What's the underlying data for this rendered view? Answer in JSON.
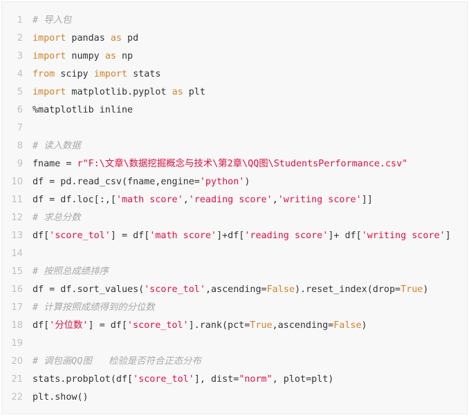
{
  "language": "python",
  "colors": {
    "background": "#f8f8f8",
    "keyword": "#d2822c",
    "string": "#dd1144",
    "comment": "#a8a8a8",
    "text": "#333333",
    "line_number": "#c0c0c0"
  },
  "lines": [
    {
      "n": "1",
      "tokens": [
        {
          "t": "cm",
          "v": "# 导入包"
        }
      ]
    },
    {
      "n": "2",
      "tokens": [
        {
          "t": "kw",
          "v": "import"
        },
        {
          "t": "nm",
          "v": " pandas "
        },
        {
          "t": "kw",
          "v": "as"
        },
        {
          "t": "nm",
          "v": " pd"
        }
      ]
    },
    {
      "n": "3",
      "tokens": [
        {
          "t": "kw",
          "v": "import"
        },
        {
          "t": "nm",
          "v": " numpy "
        },
        {
          "t": "kw",
          "v": "as"
        },
        {
          "t": "nm",
          "v": " np"
        }
      ]
    },
    {
      "n": "4",
      "tokens": [
        {
          "t": "kw",
          "v": "from"
        },
        {
          "t": "nm",
          "v": " scipy "
        },
        {
          "t": "kw",
          "v": "import"
        },
        {
          "t": "nm",
          "v": " stats"
        }
      ]
    },
    {
      "n": "5",
      "tokens": [
        {
          "t": "kw",
          "v": "import"
        },
        {
          "t": "nm",
          "v": " matplotlib.pyplot "
        },
        {
          "t": "kw",
          "v": "as"
        },
        {
          "t": "nm",
          "v": " plt"
        }
      ]
    },
    {
      "n": "6",
      "tokens": [
        {
          "t": "nm",
          "v": "%matplotlib inline"
        }
      ]
    },
    {
      "n": "7",
      "tokens": []
    },
    {
      "n": "8",
      "tokens": [
        {
          "t": "cm",
          "v": "# 读入数据"
        }
      ]
    },
    {
      "n": "9",
      "tokens": [
        {
          "t": "nm",
          "v": "fname = "
        },
        {
          "t": "str",
          "v": "r\"F:\\文章\\数据挖掘概念与技术\\第2章\\QQ图\\StudentsPerformance.csv\""
        }
      ]
    },
    {
      "n": "10",
      "tokens": [
        {
          "t": "nm",
          "v": "df = pd.read_csv(fname,engine="
        },
        {
          "t": "str",
          "v": "'python'"
        },
        {
          "t": "nm",
          "v": ")"
        }
      ]
    },
    {
      "n": "11",
      "tokens": [
        {
          "t": "nm",
          "v": "df = df.loc[:,["
        },
        {
          "t": "str",
          "v": "'math score'"
        },
        {
          "t": "nm",
          "v": ","
        },
        {
          "t": "str",
          "v": "'reading score'"
        },
        {
          "t": "nm",
          "v": ","
        },
        {
          "t": "str",
          "v": "'writing score'"
        },
        {
          "t": "nm",
          "v": "]]"
        }
      ]
    },
    {
      "n": "12",
      "tokens": [
        {
          "t": "cm",
          "v": "# 求总分数"
        }
      ]
    },
    {
      "n": "13",
      "tokens": [
        {
          "t": "nm",
          "v": "df["
        },
        {
          "t": "str",
          "v": "'score_tol'"
        },
        {
          "t": "nm",
          "v": "] = df["
        },
        {
          "t": "str",
          "v": "'math score'"
        },
        {
          "t": "nm",
          "v": "]+df["
        },
        {
          "t": "str",
          "v": "'reading score'"
        },
        {
          "t": "nm",
          "v": "]+ df["
        },
        {
          "t": "str",
          "v": "'writing score'"
        },
        {
          "t": "nm",
          "v": "]"
        }
      ]
    },
    {
      "n": "14",
      "tokens": []
    },
    {
      "n": "15",
      "tokens": [
        {
          "t": "cm",
          "v": "# 按照总成绩排序"
        }
      ]
    },
    {
      "n": "16",
      "tokens": [
        {
          "t": "nm",
          "v": "df = df.sort_values("
        },
        {
          "t": "str",
          "v": "'score_tol'"
        },
        {
          "t": "nm",
          "v": ",ascending="
        },
        {
          "t": "kw",
          "v": "False"
        },
        {
          "t": "nm",
          "v": ").reset_index(drop="
        },
        {
          "t": "kw",
          "v": "True"
        },
        {
          "t": "nm",
          "v": ")"
        }
      ]
    },
    {
      "n": "17",
      "tokens": [
        {
          "t": "cm",
          "v": "# 计算按照成绩得到的分位数"
        }
      ]
    },
    {
      "n": "18",
      "tokens": [
        {
          "t": "nm",
          "v": "df["
        },
        {
          "t": "str",
          "v": "'分位数'"
        },
        {
          "t": "nm",
          "v": "] = df["
        },
        {
          "t": "str",
          "v": "'score_tol'"
        },
        {
          "t": "nm",
          "v": "].rank(pct="
        },
        {
          "t": "kw",
          "v": "True"
        },
        {
          "t": "nm",
          "v": ",ascending="
        },
        {
          "t": "kw",
          "v": "False"
        },
        {
          "t": "nm",
          "v": ")"
        }
      ]
    },
    {
      "n": "19",
      "tokens": []
    },
    {
      "n": "20",
      "tokens": [
        {
          "t": "cm",
          "v": "# 调包画QQ图   检验是否符合正态分布"
        }
      ]
    },
    {
      "n": "21",
      "tokens": [
        {
          "t": "nm",
          "v": "stats.probplot(df["
        },
        {
          "t": "str",
          "v": "'score_tol'"
        },
        {
          "t": "nm",
          "v": "], dist="
        },
        {
          "t": "str",
          "v": "\"norm\""
        },
        {
          "t": "nm",
          "v": ", plot=plt)"
        }
      ]
    },
    {
      "n": "22",
      "tokens": [
        {
          "t": "nm",
          "v": "plt.show()"
        }
      ]
    }
  ]
}
